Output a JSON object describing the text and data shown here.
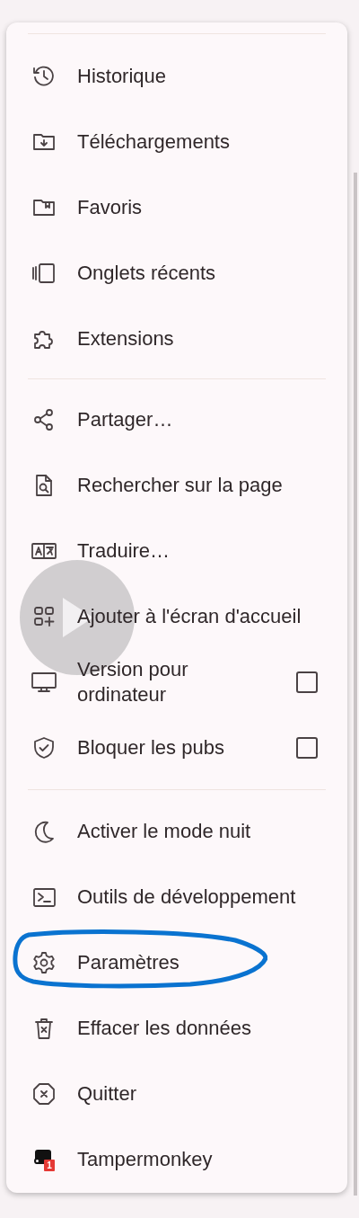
{
  "menu": {
    "sections": [
      {
        "items": [
          {
            "label": "Historique"
          },
          {
            "label": "Téléchargements"
          },
          {
            "label": "Favoris"
          },
          {
            "label": "Onglets récents"
          },
          {
            "label": "Extensions"
          }
        ]
      },
      {
        "items": [
          {
            "label": "Partager…"
          },
          {
            "label": "Rechercher sur la page"
          },
          {
            "label": "Traduire…"
          },
          {
            "label": "Ajouter à l'écran d'accueil"
          },
          {
            "label": "Version pour ordinateur",
            "checked": false
          },
          {
            "label": "Bloquer les pubs",
            "checked": false
          }
        ]
      },
      {
        "items": [
          {
            "label": "Activer le mode nuit"
          },
          {
            "label": "Outils de développement"
          },
          {
            "label": "Paramètres"
          },
          {
            "label": "Effacer les données"
          },
          {
            "label": "Quitter"
          },
          {
            "label": "Tampermonkey",
            "badge": "1"
          }
        ]
      }
    ]
  }
}
